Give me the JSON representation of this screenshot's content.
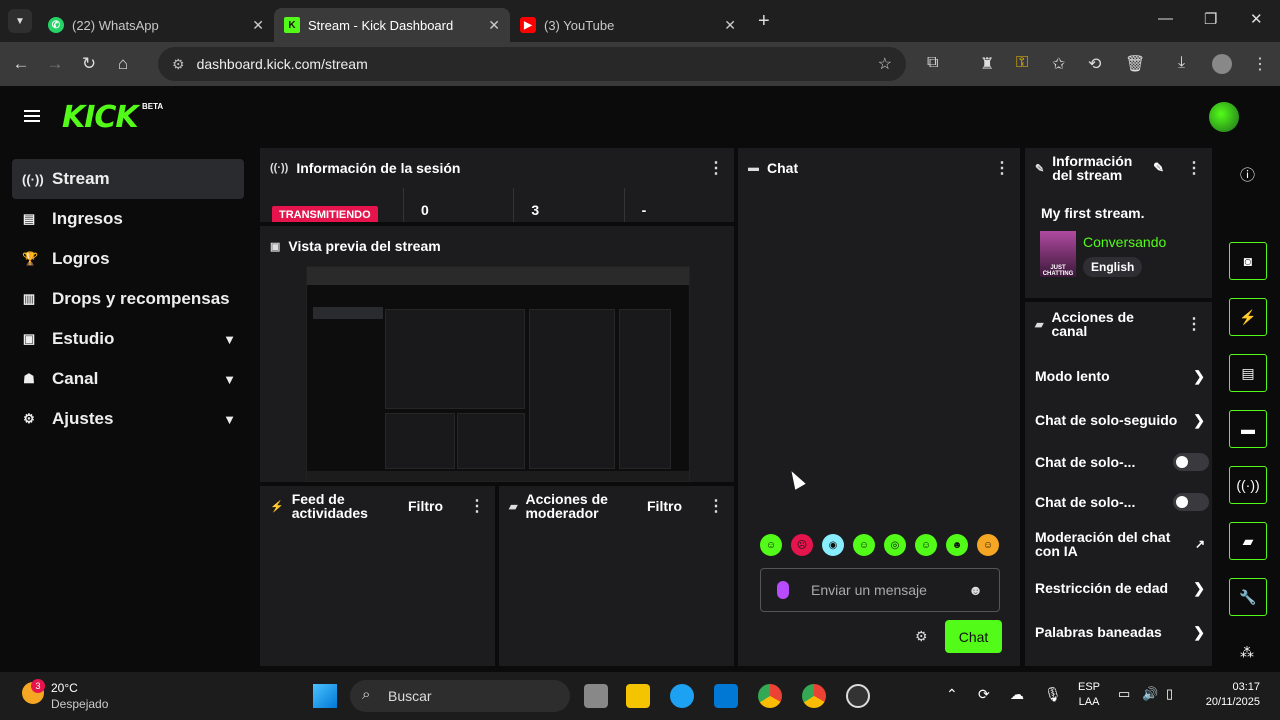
{
  "browser": {
    "tabs": [
      {
        "title": "(22) WhatsApp",
        "icon": "whatsapp-icon",
        "color": "#25d366"
      },
      {
        "title": "Stream - Kick Dashboard",
        "icon": "kick-icon",
        "color": "#53fc18"
      },
      {
        "title": "(3) YouTube",
        "icon": "youtube-icon",
        "color": "#ff0000"
      }
    ],
    "url": "dashboard.kick.com/stream"
  },
  "kick": {
    "logo": "KICK",
    "beta": "BETA",
    "accent": "#53fc18"
  },
  "sidebar": {
    "items": [
      {
        "label": "Stream",
        "icon": "broadcast-icon",
        "active": true
      },
      {
        "label": "Ingresos",
        "icon": "chart-icon"
      },
      {
        "label": "Logros",
        "icon": "trophy-icon"
      },
      {
        "label": "Drops y recompensas",
        "icon": "gift-icon"
      },
      {
        "label": "Estudio",
        "icon": "studio-icon",
        "expandable": true
      },
      {
        "label": "Canal",
        "icon": "channel-icon",
        "expandable": true
      },
      {
        "label": "Ajustes",
        "icon": "gear-icon",
        "expandable": true
      }
    ]
  },
  "session": {
    "title": "Información de la sesión",
    "status": "TRANSMITIENDO",
    "stats": [
      "0",
      "3",
      "-"
    ]
  },
  "preview": {
    "title": "Vista previa del stream"
  },
  "feed": {
    "title": "Feed de actividades",
    "filter": "Filtro"
  },
  "modactions": {
    "title": "Acciones de moderador",
    "filter": "Filtro"
  },
  "chat": {
    "title": "Chat",
    "placeholder": "Enviar un mensaje",
    "send": "Chat"
  },
  "stream_info": {
    "title": "Información del stream",
    "stream_title": "My first stream.",
    "category": "Conversando",
    "language": "English",
    "thumb_label": "JUST CHATTING"
  },
  "channel_actions": {
    "title": "Acciones de canal",
    "items": [
      {
        "label": "Modo lento",
        "kind": "chevron"
      },
      {
        "label": "Chat de solo-seguido",
        "kind": "chevron"
      },
      {
        "label": "Chat de solo-...",
        "kind": "toggle",
        "on": false
      },
      {
        "label": "Chat de solo-...",
        "kind": "toggle",
        "on": false
      },
      {
        "label": "Moderación del chat con IA",
        "kind": "external"
      },
      {
        "label": "Restricción de edad",
        "kind": "chevron"
      },
      {
        "label": "Palabras baneadas",
        "kind": "chevron"
      }
    ]
  },
  "taskbar": {
    "weather_temp": "20°C",
    "weather_desc": "Despejado",
    "weather_badge": "3",
    "search": "Buscar",
    "lang1": "ESP",
    "lang2": "LAA",
    "time": "03:17",
    "date": "20/11/2025"
  }
}
